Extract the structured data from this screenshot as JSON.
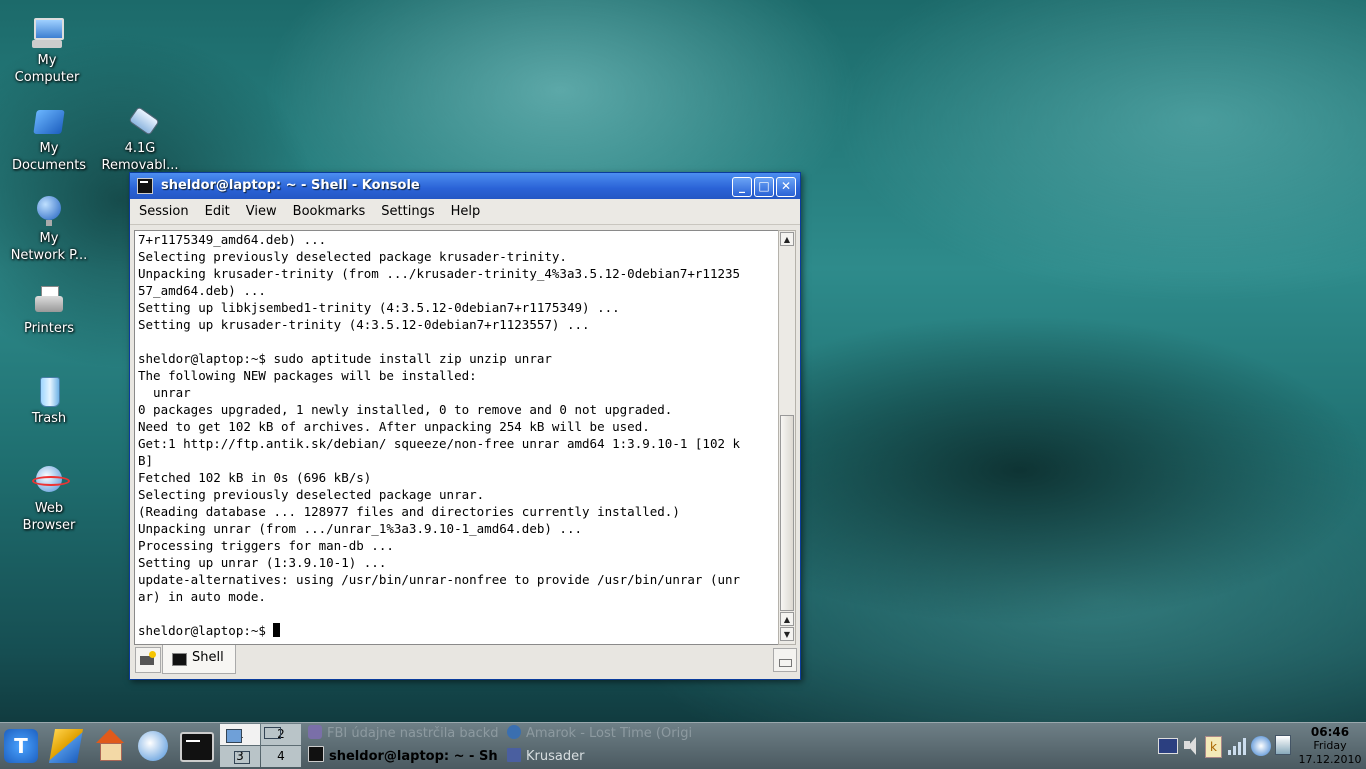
{
  "desktop": {
    "icons": [
      {
        "label": "My\nComputer"
      },
      {
        "label": "My\nDocuments"
      },
      {
        "label": "4.1G\nRemovabl..."
      },
      {
        "label": "My\nNetwork P..."
      },
      {
        "label": "Printers"
      },
      {
        "label": "Trash"
      },
      {
        "label": "Web\nBrowser"
      }
    ]
  },
  "window": {
    "title": "sheldor@laptop: ~ - Shell - Konsole",
    "buttons": {
      "minimize": "_",
      "maximize": "□",
      "close": "✕"
    },
    "menu": [
      "Session",
      "Edit",
      "View",
      "Bookmarks",
      "Settings",
      "Help"
    ],
    "terminal_lines": [
      "7+r1175349_amd64.deb) ...",
      "Selecting previously deselected package krusader-trinity.",
      "Unpacking krusader-trinity (from .../krusader-trinity_4%3a3.5.12-0debian7+r11235",
      "57_amd64.deb) ...",
      "Setting up libkjsembed1-trinity (4:3.5.12-0debian7+r1175349) ...",
      "Setting up krusader-trinity (4:3.5.12-0debian7+r1123557) ...",
      "",
      "sheldor@laptop:~$ sudo aptitude install zip unzip unrar",
      "The following NEW packages will be installed:",
      "  unrar",
      "0 packages upgraded, 1 newly installed, 0 to remove and 0 not upgraded.",
      "Need to get 102 kB of archives. After unpacking 254 kB will be used.",
      "Get:1 http://ftp.antik.sk/debian/ squeeze/non-free unrar amd64 1:3.9.10-1 [102 k",
      "B]",
      "Fetched 102 kB in 0s (696 kB/s)",
      "Selecting previously deselected package unrar.",
      "(Reading database ... 128977 files and directories currently installed.)",
      "Unpacking unrar (from .../unrar_1%3a3.9.10-1_amd64.deb) ...",
      "Processing triggers for man-db ...",
      "Setting up unrar (1:3.9.10-1) ...",
      "update-alternatives: using /usr/bin/unrar-nonfree to provide /usr/bin/unrar (unr",
      "ar) in auto mode.",
      ""
    ],
    "prompt": "sheldor@laptop:~$ ",
    "tab_label": "Shell"
  },
  "taskbar": {
    "pager": [
      "1",
      "2",
      "3",
      "4"
    ],
    "tasks": [
      "FBI údajne nastrčila backd",
      "Amarok - Lost Time (Origi",
      "sheldor@laptop: ~ - Sh",
      "Krusader"
    ],
    "clock": {
      "time": "06:46",
      "day": "Friday",
      "date": "17.12.2010"
    }
  }
}
